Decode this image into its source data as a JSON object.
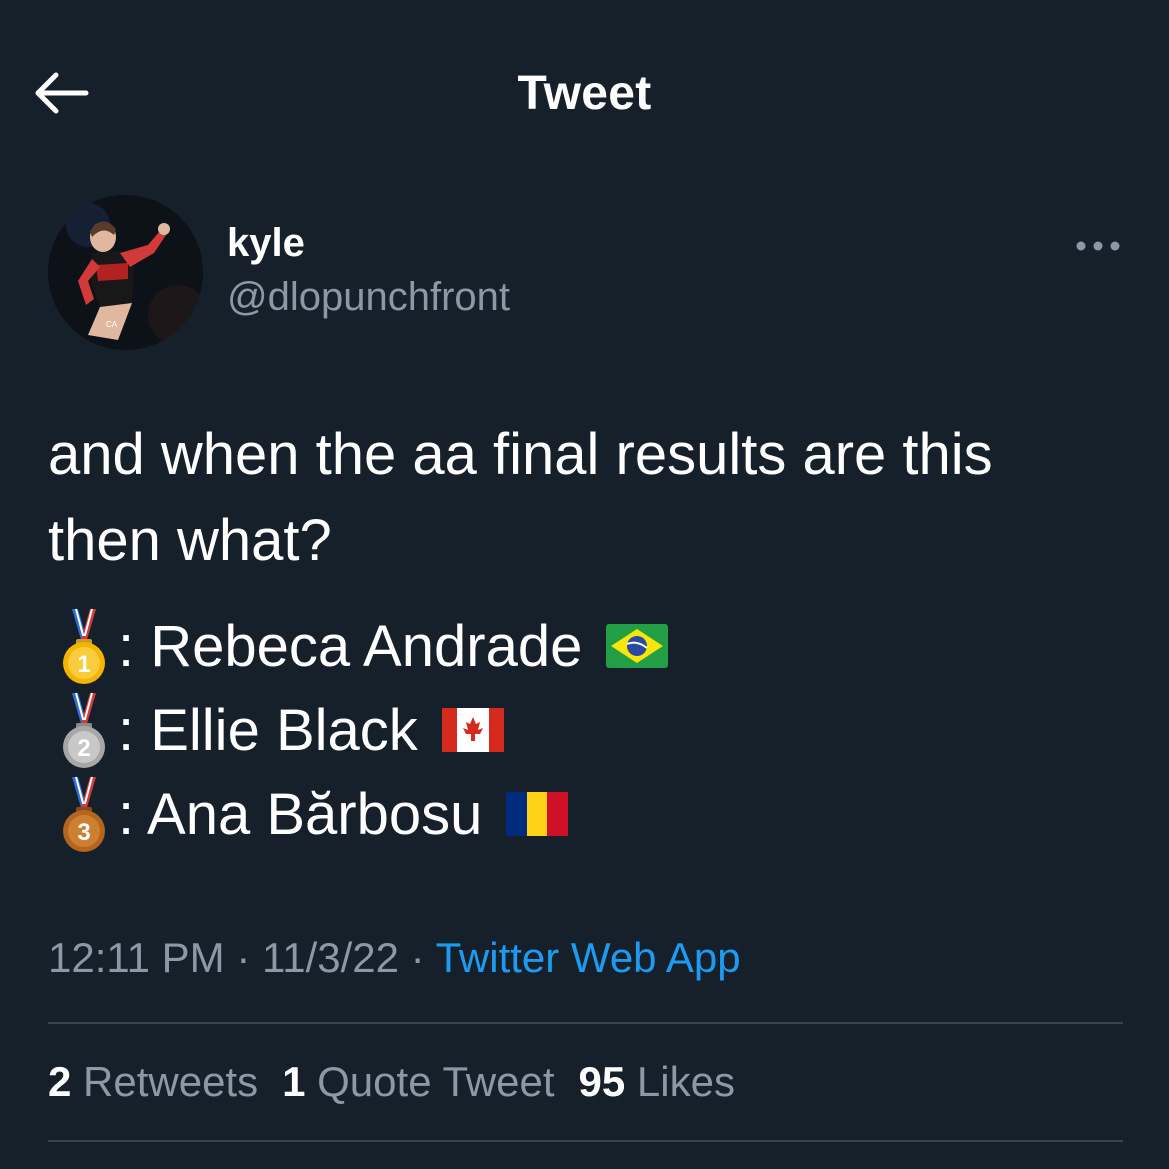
{
  "header": {
    "title": "Tweet"
  },
  "author": {
    "display_name": "kyle",
    "handle": "@dlopunchfront"
  },
  "tweet": {
    "text_line1": "and when the aa final results are this",
    "text_line2": "then what?",
    "results": [
      {
        "medal": "1st-place-medal",
        "medal_number": "1",
        "text": ": Rebeca Andrade",
        "flag": "brazil-flag"
      },
      {
        "medal": "2nd-place-medal",
        "medal_number": "2",
        "text": ": Ellie Black",
        "flag": "canada-flag"
      },
      {
        "medal": "3rd-place-medal",
        "medal_number": "3",
        "text": ": Ana Bărbosu",
        "flag": "romania-flag"
      }
    ]
  },
  "meta": {
    "time": "12:11 PM",
    "separator": " · ",
    "date": "11/3/22",
    "source": "Twitter Web App"
  },
  "stats": {
    "retweets_count": "2",
    "retweets_label": " Retweets",
    "quotes_count": "1",
    "quotes_label": " Quote Tweet",
    "likes_count": "95",
    "likes_label": " Likes"
  },
  "colors": {
    "background": "#15202b",
    "secondary_text": "#8b98a5",
    "link": "#1d9bf0",
    "divider": "#38444d"
  }
}
